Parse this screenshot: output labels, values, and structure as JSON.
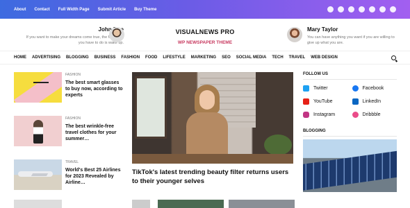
{
  "top_links": [
    "About",
    "Contact",
    "Full Width Page",
    "Submit Article",
    "Buy Theme"
  ],
  "header": {
    "left_quote": {
      "name": "John Doe",
      "text": "If you want to make your dreams come true, the first thing you have to do is wake up."
    },
    "right_quote": {
      "name": "Mary Taylor",
      "text": "You can have anything you want if you are willing to give up what you are."
    },
    "logo_title": "VISUALNEWS PRO",
    "logo_subtitle": "WP NEWSPAPER THEME"
  },
  "nav": [
    "HOME",
    "ADVERTISING",
    "BLOGGING",
    "BUSINESS",
    "FASHION",
    "FOOD",
    "LIFESTYLE",
    "MARKETING",
    "SEO",
    "SOCIAL MEDIA",
    "TECH",
    "TRAVEL",
    "WEB DESIGN"
  ],
  "articles": [
    {
      "category": "FASHION",
      "title": "The best smart glasses to buy now, according to experts"
    },
    {
      "category": "FASHION",
      "title": "The best wrinkle-free travel clothes for your summer…"
    },
    {
      "category": "TRAVEL",
      "title": "World's Best 25 Airlines for 2023 Revealed by Airline…"
    }
  ],
  "hero": {
    "title": "TikTok's latest trending beauty filter returns users to their younger selves"
  },
  "sidebar": {
    "follow_title": "FOLLOW US",
    "socials": [
      {
        "name": "Twitter",
        "color": "#1da1f2",
        "icon": "twitter-icon"
      },
      {
        "name": "Facebook",
        "color": "#1877f2",
        "icon": "facebook-icon"
      },
      {
        "name": "YouTube",
        "color": "#e62117",
        "icon": "youtube-icon"
      },
      {
        "name": "LinkedIn",
        "color": "#0a66c2",
        "icon": "linkedin-icon"
      },
      {
        "name": "Instagram",
        "color": "#c13584",
        "icon": "instagram-icon"
      },
      {
        "name": "Dribbble",
        "color": "#ea4c89",
        "icon": "dribbble-icon"
      }
    ],
    "blogging_title": "BLOGGING"
  },
  "colors": {
    "accent": "#c7385e",
    "topbar_start": "#3d6be0",
    "topbar_end": "#a25ff0"
  }
}
